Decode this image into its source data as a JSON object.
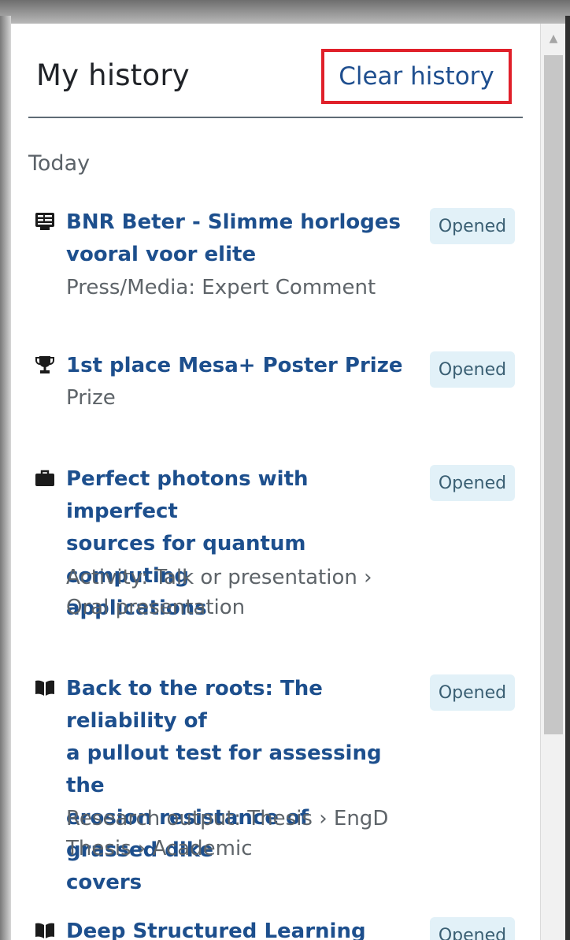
{
  "header": {
    "title": "My history",
    "clear_label": "Clear history"
  },
  "section": {
    "label": "Today"
  },
  "items": [
    {
      "icon": "press-media-icon",
      "title_lines": [
        "BNR Beter - Slimme horloges",
        "vooral voor elite"
      ],
      "type_lines": [
        "Press/Media: Expert Comment"
      ],
      "status": "Opened"
    },
    {
      "icon": "trophy-icon",
      "title_lines": [
        "1st place Mesa+ Poster Prize"
      ],
      "type_lines": [
        "Prize"
      ],
      "status": "Opened"
    },
    {
      "icon": "briefcase-icon",
      "title_lines": [
        "Perfect photons with imperfect",
        "sources for quantum computing",
        "applications"
      ],
      "type_lines": [
        "Activity: Talk or presentation ›",
        "Oral presentation"
      ],
      "status": "Opened"
    },
    {
      "icon": "book-icon",
      "title_lines": [
        "Back to the roots: The reliability of",
        "a pullout test for assessing the",
        "erosion resistance of grassed dike",
        "covers"
      ],
      "type_lines": [
        "Research output: Thesis › EngD",
        "Thesis › Academic"
      ],
      "status": "Opened"
    },
    {
      "icon": "book-icon",
      "title_lines": [
        "Deep Structured Learning for"
      ],
      "type_lines": [],
      "status": "Opened"
    }
  ],
  "scrollbar": {
    "up_arrow": "▲"
  }
}
